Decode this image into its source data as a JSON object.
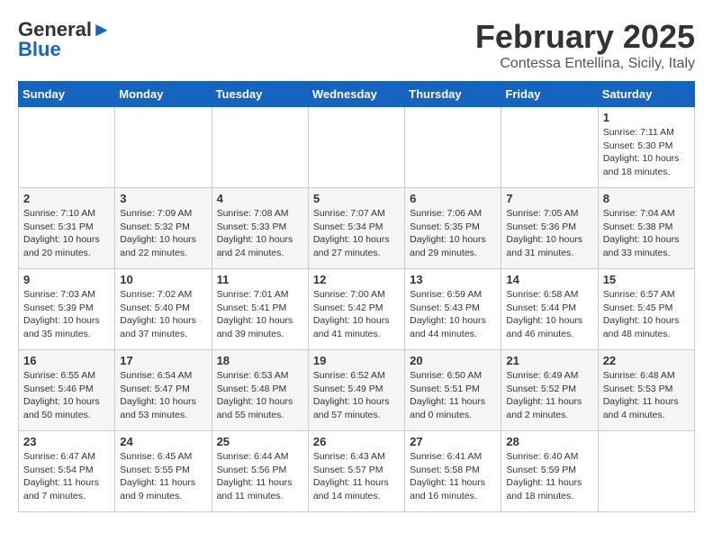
{
  "header": {
    "logo_general": "General",
    "logo_blue": "Blue",
    "month": "February 2025",
    "location": "Contessa Entellina, Sicily, Italy"
  },
  "days_of_week": [
    "Sunday",
    "Monday",
    "Tuesday",
    "Wednesday",
    "Thursday",
    "Friday",
    "Saturday"
  ],
  "weeks": [
    [
      {
        "day": "",
        "info": ""
      },
      {
        "day": "",
        "info": ""
      },
      {
        "day": "",
        "info": ""
      },
      {
        "day": "",
        "info": ""
      },
      {
        "day": "",
        "info": ""
      },
      {
        "day": "",
        "info": ""
      },
      {
        "day": "1",
        "info": "Sunrise: 7:11 AM\nSunset: 5:30 PM\nDaylight: 10 hours\nand 18 minutes."
      }
    ],
    [
      {
        "day": "2",
        "info": "Sunrise: 7:10 AM\nSunset: 5:31 PM\nDaylight: 10 hours\nand 20 minutes."
      },
      {
        "day": "3",
        "info": "Sunrise: 7:09 AM\nSunset: 5:32 PM\nDaylight: 10 hours\nand 22 minutes."
      },
      {
        "day": "4",
        "info": "Sunrise: 7:08 AM\nSunset: 5:33 PM\nDaylight: 10 hours\nand 24 minutes."
      },
      {
        "day": "5",
        "info": "Sunrise: 7:07 AM\nSunset: 5:34 PM\nDaylight: 10 hours\nand 27 minutes."
      },
      {
        "day": "6",
        "info": "Sunrise: 7:06 AM\nSunset: 5:35 PM\nDaylight: 10 hours\nand 29 minutes."
      },
      {
        "day": "7",
        "info": "Sunrise: 7:05 AM\nSunset: 5:36 PM\nDaylight: 10 hours\nand 31 minutes."
      },
      {
        "day": "8",
        "info": "Sunrise: 7:04 AM\nSunset: 5:38 PM\nDaylight: 10 hours\nand 33 minutes."
      }
    ],
    [
      {
        "day": "9",
        "info": "Sunrise: 7:03 AM\nSunset: 5:39 PM\nDaylight: 10 hours\nand 35 minutes."
      },
      {
        "day": "10",
        "info": "Sunrise: 7:02 AM\nSunset: 5:40 PM\nDaylight: 10 hours\nand 37 minutes."
      },
      {
        "day": "11",
        "info": "Sunrise: 7:01 AM\nSunset: 5:41 PM\nDaylight: 10 hours\nand 39 minutes."
      },
      {
        "day": "12",
        "info": "Sunrise: 7:00 AM\nSunset: 5:42 PM\nDaylight: 10 hours\nand 41 minutes."
      },
      {
        "day": "13",
        "info": "Sunrise: 6:59 AM\nSunset: 5:43 PM\nDaylight: 10 hours\nand 44 minutes."
      },
      {
        "day": "14",
        "info": "Sunrise: 6:58 AM\nSunset: 5:44 PM\nDaylight: 10 hours\nand 46 minutes."
      },
      {
        "day": "15",
        "info": "Sunrise: 6:57 AM\nSunset: 5:45 PM\nDaylight: 10 hours\nand 48 minutes."
      }
    ],
    [
      {
        "day": "16",
        "info": "Sunrise: 6:55 AM\nSunset: 5:46 PM\nDaylight: 10 hours\nand 50 minutes."
      },
      {
        "day": "17",
        "info": "Sunrise: 6:54 AM\nSunset: 5:47 PM\nDaylight: 10 hours\nand 53 minutes."
      },
      {
        "day": "18",
        "info": "Sunrise: 6:53 AM\nSunset: 5:48 PM\nDaylight: 10 hours\nand 55 minutes."
      },
      {
        "day": "19",
        "info": "Sunrise: 6:52 AM\nSunset: 5:49 PM\nDaylight: 10 hours\nand 57 minutes."
      },
      {
        "day": "20",
        "info": "Sunrise: 6:50 AM\nSunset: 5:51 PM\nDaylight: 11 hours\nand 0 minutes."
      },
      {
        "day": "21",
        "info": "Sunrise: 6:49 AM\nSunset: 5:52 PM\nDaylight: 11 hours\nand 2 minutes."
      },
      {
        "day": "22",
        "info": "Sunrise: 6:48 AM\nSunset: 5:53 PM\nDaylight: 11 hours\nand 4 minutes."
      }
    ],
    [
      {
        "day": "23",
        "info": "Sunrise: 6:47 AM\nSunset: 5:54 PM\nDaylight: 11 hours\nand 7 minutes."
      },
      {
        "day": "24",
        "info": "Sunrise: 6:45 AM\nSunset: 5:55 PM\nDaylight: 11 hours\nand 9 minutes."
      },
      {
        "day": "25",
        "info": "Sunrise: 6:44 AM\nSunset: 5:56 PM\nDaylight: 11 hours\nand 11 minutes."
      },
      {
        "day": "26",
        "info": "Sunrise: 6:43 AM\nSunset: 5:57 PM\nDaylight: 11 hours\nand 14 minutes."
      },
      {
        "day": "27",
        "info": "Sunrise: 6:41 AM\nSunset: 5:58 PM\nDaylight: 11 hours\nand 16 minutes."
      },
      {
        "day": "28",
        "info": "Sunrise: 6:40 AM\nSunset: 5:59 PM\nDaylight: 11 hours\nand 18 minutes."
      },
      {
        "day": "",
        "info": ""
      }
    ]
  ]
}
